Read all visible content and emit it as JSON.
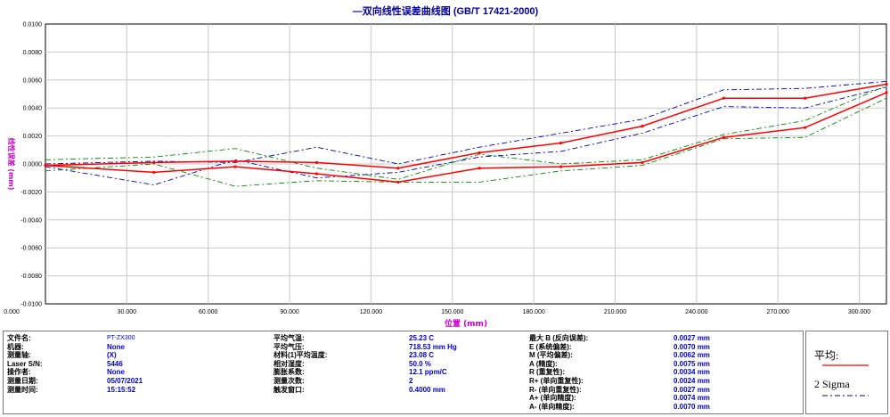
{
  "colors": {
    "axis_title": "#cc00cc",
    "title": "#000099",
    "info_value": "#0000cc",
    "avg_line": "#ff0000",
    "sigma_blue": "#0000aa",
    "sigma_green": "#008800"
  },
  "chart_data": {
    "type": "line",
    "title": "—双向线性误差曲线图  (GB/T 17421-2000)",
    "xlabel": "位置 (mm)",
    "ylabel": "线性误差 (mm)",
    "xlim": [
      0,
      310
    ],
    "ylim": [
      -0.01,
      0.01
    ],
    "x_ticks": [
      "0.000",
      "30.000",
      "60.000",
      "90.000",
      "120.000",
      "150.000",
      "180.000",
      "210.000",
      "240.000",
      "270.000",
      "300.000"
    ],
    "y_ticks": [
      "0.0100",
      "0.0080",
      "0.0060",
      "0.0040",
      "0.0020",
      "0.0000",
      "-0.0020",
      "-0.0040",
      "-0.0060",
      "-0.0080",
      "-0.0100"
    ],
    "grid": true,
    "x": [
      0,
      40,
      70,
      100,
      130,
      160,
      190,
      220,
      250,
      280,
      310
    ],
    "series": [
      {
        "name": "平均",
        "group": "forward",
        "color": "#ff0000",
        "dash": "",
        "values": [
          -0.0001,
          0.0001,
          0.0002,
          0.0001,
          -0.0003,
          0.0008,
          0.0015,
          0.0027,
          0.0047,
          0.0047,
          0.0057
        ]
      },
      {
        "name": "平均",
        "group": "reverse",
        "color": "#ff0000",
        "dash": "",
        "values": [
          -0.0001,
          -0.0006,
          -0.0002,
          -0.0007,
          -0.0013,
          -0.0003,
          -0.0002,
          0.0001,
          0.0019,
          0.0026,
          0.0051
        ]
      },
      {
        "name": "2 Sigma",
        "group": "forward-upper",
        "color": "#0000aa",
        "dash": "6,3,2,3",
        "values": [
          0.0,
          0.0002,
          0.0001,
          0.0012,
          0.0,
          0.0012,
          0.0022,
          0.0032,
          0.0053,
          0.0054,
          0.0059
        ]
      },
      {
        "name": "2 Sigma",
        "group": "forward-lower",
        "color": "#0000aa",
        "dash": "6,3,2,3",
        "values": [
          -0.0002,
          -0.0015,
          0.0003,
          -0.001,
          -0.0006,
          0.0005,
          0.0009,
          0.0022,
          0.0041,
          0.004,
          0.0055
        ]
      },
      {
        "name": "2 Sigma",
        "group": "reverse-upper",
        "color": "#008800",
        "dash": "6,3,2,3",
        "values": [
          0.0003,
          0.0005,
          0.0011,
          -0.0003,
          -0.0011,
          0.0007,
          0.0,
          0.0003,
          0.0021,
          0.0031,
          0.0056
        ]
      },
      {
        "name": "2 Sigma",
        "group": "reverse-lower",
        "color": "#008800",
        "dash": "6,3,2,3",
        "values": [
          -0.0005,
          0.0,
          -0.0016,
          -0.0012,
          -0.0013,
          -0.0013,
          -0.0005,
          -0.0001,
          0.0018,
          0.0019,
          0.0047
        ]
      }
    ]
  },
  "info": {
    "col1": [
      {
        "label": "文件名:",
        "value": "PT-ZX300"
      },
      {
        "label": "机器:",
        "value": "None"
      },
      {
        "label": "测量轴:",
        "value": "(X)"
      },
      {
        "label": "Laser S/N:",
        "value": "5446"
      },
      {
        "label": "操作者:",
        "value": "None"
      },
      {
        "label": "测量日期:",
        "value": "05/07/2021"
      },
      {
        "label": "测量时间:",
        "value": "15:15:52"
      }
    ],
    "col2": [
      {
        "label": "平均气温:",
        "value": "25.23 C"
      },
      {
        "label": "平均气压:",
        "value": "718.53 mm Hg"
      },
      {
        "label": "材料(1)平均温度:",
        "value": "23.08 C"
      },
      {
        "label": "相对湿度:",
        "value": "50.0 %"
      },
      {
        "label": "膨胀系数:",
        "value": "12.1 ppm/C"
      },
      {
        "label": "测量次数:",
        "value": "2"
      },
      {
        "label": "触发窗口:",
        "value": "0.4000 mm"
      }
    ],
    "col3": [
      {
        "label": "最大 B (反向误差):",
        "value": "0.0027 mm"
      },
      {
        "label": "E (系统偏差):",
        "value": "0.0070 mm"
      },
      {
        "label": "M (平均偏差):",
        "value": "0.0062 mm"
      },
      {
        "label": "A (精度):",
        "value": "0.0075 mm"
      },
      {
        "label": "R (重复性):",
        "value": "0.0034 mm"
      },
      {
        "label": "R+ (单向重复性):",
        "value": "0.0024 mm"
      },
      {
        "label": "R- (单向重复性):",
        "value": "0.0027 mm"
      },
      {
        "label": "A+ (单向精度):",
        "value": "0.0074 mm"
      },
      {
        "label": "A- (单向精度):",
        "value": "0.0070 mm"
      }
    ]
  },
  "legend": {
    "items": [
      {
        "label": "平均:",
        "color": "#ff0000",
        "dash": ""
      },
      {
        "label": "2 Sigma",
        "color": "#0000aa",
        "dash": "6,3,2,3"
      }
    ]
  }
}
